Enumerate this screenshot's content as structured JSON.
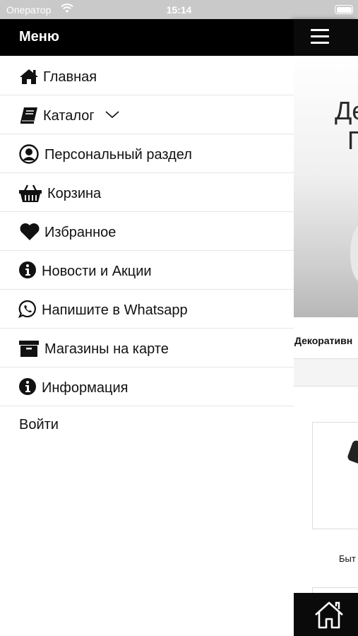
{
  "status_bar": {
    "carrier": "Оператор",
    "time": "15:14"
  },
  "menu": {
    "title": "Меню",
    "items": [
      {
        "label": "Главная",
        "icon": "home-icon"
      },
      {
        "label": "Каталог",
        "icon": "book-icon"
      },
      {
        "label": "Персональный раздел",
        "icon": "user-icon"
      },
      {
        "label": "Корзина",
        "icon": "basket-icon"
      },
      {
        "label": "Избранное",
        "icon": "heart-icon"
      },
      {
        "label": "Новости и Акции",
        "icon": "info-icon"
      },
      {
        "label": "Напишите в Whatsapp",
        "icon": "whatsapp-icon"
      },
      {
        "label": "Магазины на карте",
        "icon": "archive-icon"
      },
      {
        "label": "Информация",
        "icon": "info-icon"
      }
    ],
    "login": "Войти"
  },
  "background_app": {
    "banner_line1": "Де",
    "banner_line2": "П",
    "banner_caption": "Декоративн",
    "card_label": "Быт"
  },
  "colors": {
    "header": "#000000",
    "status_bar": "#c9c9c9",
    "text": "#111111"
  }
}
